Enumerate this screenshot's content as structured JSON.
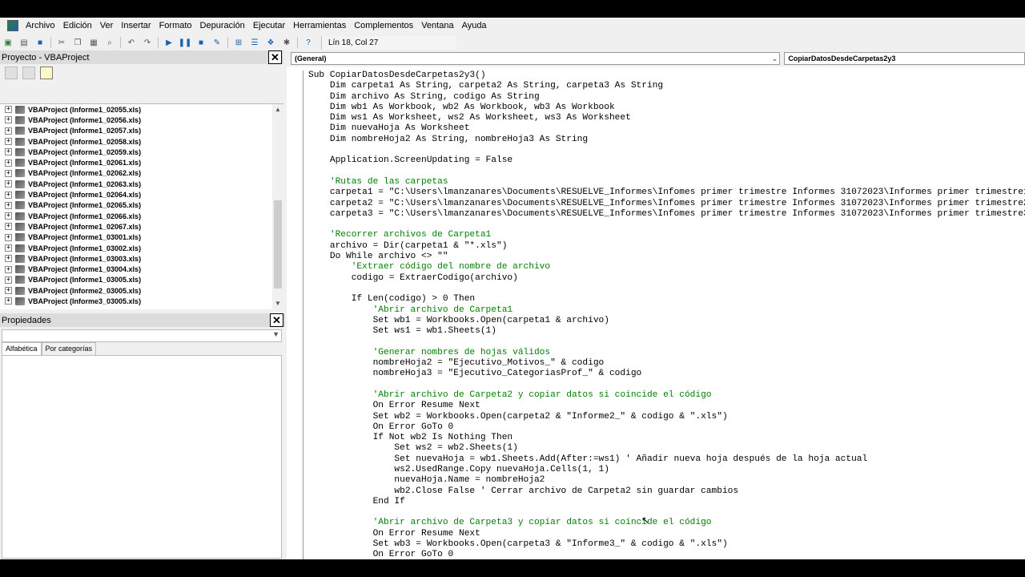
{
  "menu": [
    "Archivo",
    "Edición",
    "Ver",
    "Insertar",
    "Formato",
    "Depuración",
    "Ejecutar",
    "Herramientas",
    "Complementos",
    "Ventana",
    "Ayuda"
  ],
  "toolbar": {
    "position": "Lín 18, Col 27"
  },
  "project": {
    "title": "Proyecto - VBAProject",
    "items": [
      "VBAProject (Informe1_02055.xls)",
      "VBAProject (Informe1_02056.xls)",
      "VBAProject (Informe1_02057.xls)",
      "VBAProject (Informe1_02058.xls)",
      "VBAProject (Informe1_02059.xls)",
      "VBAProject (Informe1_02061.xls)",
      "VBAProject (Informe1_02062.xls)",
      "VBAProject (Informe1_02063.xls)",
      "VBAProject (Informe1_02064.xls)",
      "VBAProject (Informe1_02065.xls)",
      "VBAProject (Informe1_02066.xls)",
      "VBAProject (Informe1_02067.xls)",
      "VBAProject (Informe1_03001.xls)",
      "VBAProject (Informe1_03002.xls)",
      "VBAProject (Informe1_03003.xls)",
      "VBAProject (Informe1_03004.xls)",
      "VBAProject (Informe1_03005.xls)",
      "VBAProject (Informe2_03005.xls)",
      "VBAProject (Informe3_03005.xls)"
    ]
  },
  "properties": {
    "title": "Propiedades",
    "tabs": [
      "Alfabética",
      "Por categorías"
    ]
  },
  "code": {
    "object_combo": "(General)",
    "proc_combo": "CopiarDatosDesdeCarpetas2y3",
    "lines": [
      "Sub CopiarDatosDesdeCarpetas2y3()",
      "    Dim carpeta1 As String, carpeta2 As String, carpeta3 As String",
      "    Dim archivo As String, codigo As String",
      "    Dim wb1 As Workbook, wb2 As Workbook, wb3 As Workbook",
      "    Dim ws1 As Worksheet, ws2 As Worksheet, ws3 As Worksheet",
      "    Dim nuevaHoja As Worksheet",
      "    Dim nombreHoja2 As String, nombreHoja3 As String",
      "",
      "    Application.ScreenUpdating = False",
      "",
      "    'Rutas de las carpetas",
      "    carpeta1 = \"C:\\Users\\lmanzanares\\Documents\\RESUELVE_Informes\\Infomes primer trimestre Informes 31072023\\Informes primer trimestre1",
      "    carpeta2 = \"C:\\Users\\lmanzanares\\Documents\\RESUELVE_Informes\\Infomes primer trimestre Informes 31072023\\Informes primer trimestre2",
      "    carpeta3 = \"C:\\Users\\lmanzanares\\Documents\\RESUELVE_Informes\\Infomes primer trimestre Informes 31072023\\Informes primer trimestre3",
      "",
      "    'Recorrer archivos de Carpeta1",
      "    archivo = Dir(carpeta1 & \"*.xls\")",
      "    Do While archivo <> \"\"",
      "        'Extraer código del nombre de archivo",
      "        codigo = ExtraerCodigo(archivo)",
      "",
      "        If Len(codigo) > 0 Then",
      "            'Abrir archivo de Carpeta1",
      "            Set wb1 = Workbooks.Open(carpeta1 & archivo)",
      "            Set ws1 = wb1.Sheets(1)",
      "",
      "            'Generar nombres de hojas válidos",
      "            nombreHoja2 = \"Ejecutivo_Motivos_\" & codigo",
      "            nombreHoja3 = \"Ejecutivo_CategoriasProf_\" & codigo",
      "",
      "            'Abrir archivo de Carpeta2 y copiar datos si coincide el código",
      "            On Error Resume Next",
      "            Set wb2 = Workbooks.Open(carpeta2 & \"Informe2_\" & codigo & \".xls\")",
      "            On Error GoTo 0",
      "            If Not wb2 Is Nothing Then",
      "                Set ws2 = wb2.Sheets(1)",
      "                Set nuevaHoja = wb1.Sheets.Add(After:=ws1) ' Añadir nueva hoja después de la hoja actual",
      "                ws2.UsedRange.Copy nuevaHoja.Cells(1, 1)",
      "                nuevaHoja.Name = nombreHoja2",
      "                wb2.Close False ' Cerrar archivo de Carpeta2 sin guardar cambios",
      "            End If",
      "",
      "            'Abrir archivo de Carpeta3 y copiar datos si coincide el código",
      "            On Error Resume Next",
      "            Set wb3 = Workbooks.Open(carpeta3 & \"Informe3_\" & codigo & \".xls\")",
      "            On Error GoTo 0"
    ]
  }
}
